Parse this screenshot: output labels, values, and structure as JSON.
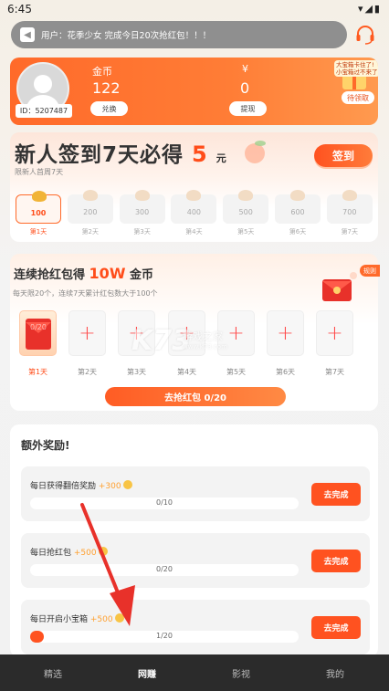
{
  "status_bar": {
    "time": "6:45",
    "icons": "▾◢▮"
  },
  "notice": {
    "text": "用户：花季少女 完成今日20次抢红包！！！"
  },
  "profile": {
    "uid_label": "ID：5207487",
    "coin_label": "金币",
    "coin_value": "122",
    "exchange_label": "兑换",
    "money_label": "¥",
    "money_value": "0",
    "withdraw_label": "提现",
    "gift_bubble": "大宝箱卡住了!\n小宝箱过不来了",
    "pending_label": "待领取"
  },
  "signin": {
    "title_prefix": "新人签到7天必得",
    "title_number": "5",
    "title_unit": "元",
    "subtitle": "限新人首周7天",
    "button": "签到",
    "days": [
      {
        "amount": "100",
        "label": "第1天",
        "active": true
      },
      {
        "amount": "200",
        "label": "第2天",
        "active": false
      },
      {
        "amount": "300",
        "label": "第3天",
        "active": false
      },
      {
        "amount": "400",
        "label": "第4天",
        "active": false
      },
      {
        "amount": "500",
        "label": "第5天",
        "active": false
      },
      {
        "amount": "600",
        "label": "第6天",
        "active": false
      },
      {
        "amount": "700",
        "label": "第7天",
        "active": false
      }
    ]
  },
  "grab": {
    "title_prefix": "连续抢红包得",
    "title_highlight": "10W",
    "title_suffix": "金币",
    "subtitle": "每天限20个，连续7天累计红包数大于100个",
    "rule_tag": "规则",
    "first_count": "0/20",
    "slot_plus": "+",
    "day_labels": [
      "第1天",
      "第2天",
      "第3天",
      "第4天",
      "第5天",
      "第6天",
      "第7天"
    ],
    "button": "去抢红包 0/20"
  },
  "extra": {
    "title": "额外奖励!",
    "tasks": [
      {
        "name": "每日获得翻倍奖励",
        "reward": "+300",
        "progress": "0/10",
        "ratio": 0.0,
        "button": "去完成"
      },
      {
        "name": "每日抢红包",
        "reward": "+500",
        "progress": "0/20",
        "ratio": 0.0,
        "button": "去完成"
      },
      {
        "name": "每日开启小宝箱",
        "reward": "+500",
        "progress": "1/20",
        "ratio": 0.05,
        "button": "去完成"
      }
    ]
  },
  "watermark": {
    "brand": "K73",
    "cn": "游戏之家",
    "url": "www.k73.com"
  },
  "bottom_nav": [
    {
      "label": "精选",
      "active": false
    },
    {
      "label": "网赚",
      "active": true
    },
    {
      "label": "影视",
      "active": false
    },
    {
      "label": "我的",
      "active": false
    }
  ],
  "colors": {
    "accent": "#ff5220",
    "gold": "#f1b437",
    "nav_bg": "#2b2b2b",
    "arrow": "#e8312a"
  }
}
